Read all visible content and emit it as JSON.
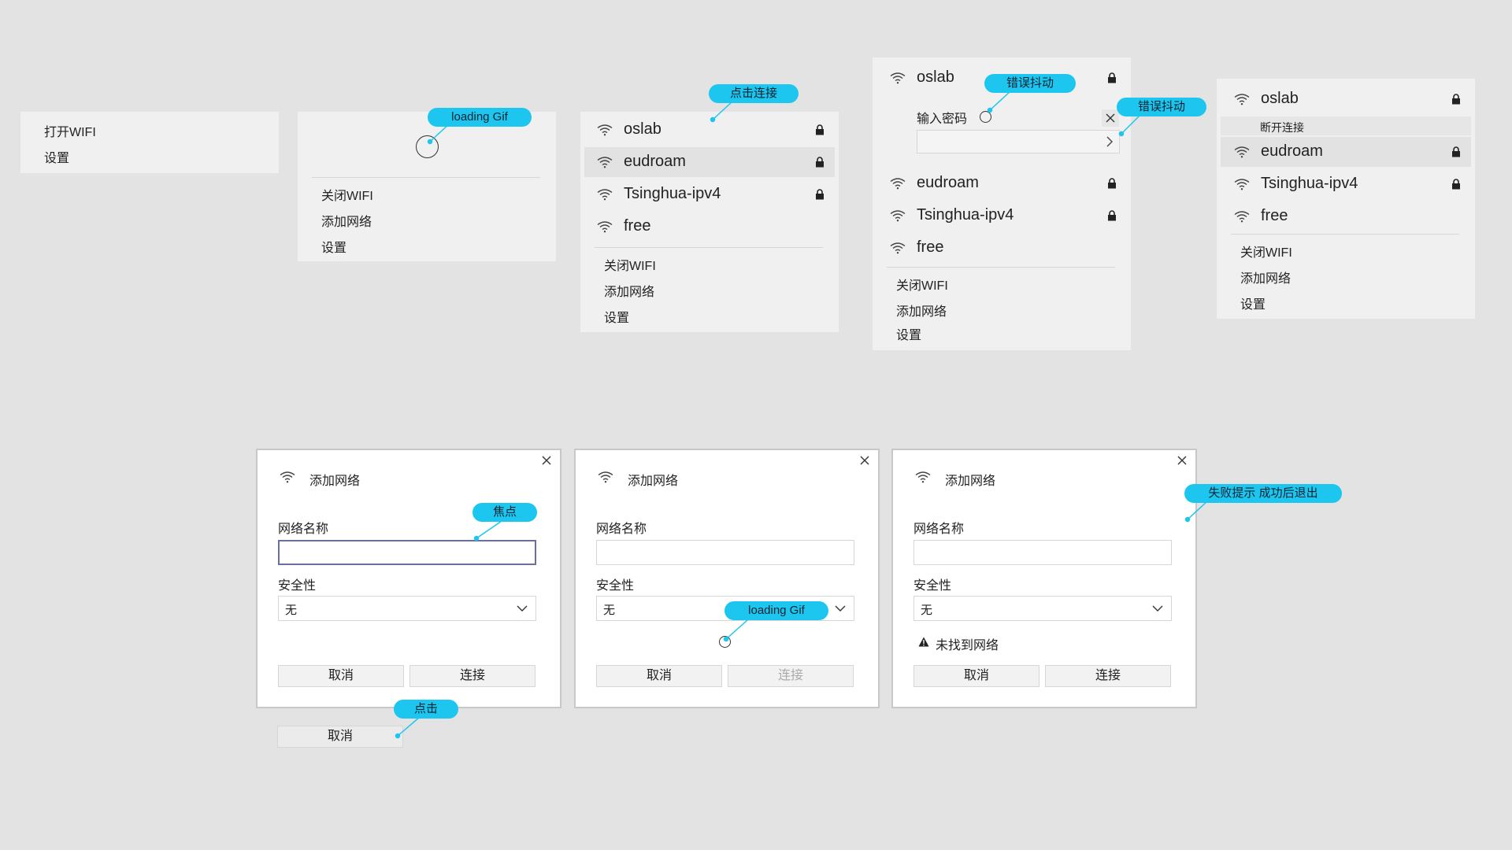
{
  "colors": {
    "background": "#e3e3e3",
    "panel": "#f0f0f0",
    "accent": "#1cc6ee",
    "focus_border": "#6b6fa0"
  },
  "panel1": {
    "items": [
      "打开WIFI",
      "设置"
    ]
  },
  "panel2": {
    "loading_label": "loading Gif",
    "items": [
      "关闭WIFI",
      "添加网络",
      "设置"
    ]
  },
  "panel3": {
    "callout": "点击连接",
    "networks": [
      {
        "name": "oslab",
        "locked": true
      },
      {
        "name": "eudroam",
        "locked": true,
        "highlighted": true
      },
      {
        "name": "Tsinghua-ipv4",
        "locked": true
      },
      {
        "name": "free",
        "locked": false
      }
    ],
    "items": [
      "关闭WIFI",
      "添加网络",
      "设置"
    ]
  },
  "panel4": {
    "callout_1": "错误抖动",
    "callout_2": "错误抖动",
    "password_label": "输入密码",
    "networks": [
      {
        "name": "oslab",
        "locked": true
      },
      {
        "name": "eudroam",
        "locked": true
      },
      {
        "name": "Tsinghua-ipv4",
        "locked": true
      },
      {
        "name": "free",
        "locked": false
      }
    ],
    "items": [
      "关闭WIFI",
      "添加网络",
      "设置"
    ]
  },
  "panel5": {
    "disconnect_label": "断开连接",
    "networks": [
      {
        "name": "oslab",
        "locked": true
      },
      {
        "name": "eudroam",
        "locked": true
      },
      {
        "name": "Tsinghua-ipv4",
        "locked": true
      },
      {
        "name": "free",
        "locked": false
      }
    ],
    "items": [
      "关闭WIFI",
      "添加网络",
      "设置"
    ]
  },
  "dialog": {
    "title": "添加网络",
    "name_label": "网络名称",
    "security_label": "安全性",
    "security_value": "无",
    "cancel": "取消",
    "connect": "连接"
  },
  "dialog1": {
    "callout_focus": "焦点",
    "callout_click": "点击",
    "pressed_cancel": "取消"
  },
  "dialog2": {
    "callout_loading": "loading Gif"
  },
  "dialog3": {
    "error_text": "未找到网络",
    "callout": "失败提示 成功后退出"
  }
}
